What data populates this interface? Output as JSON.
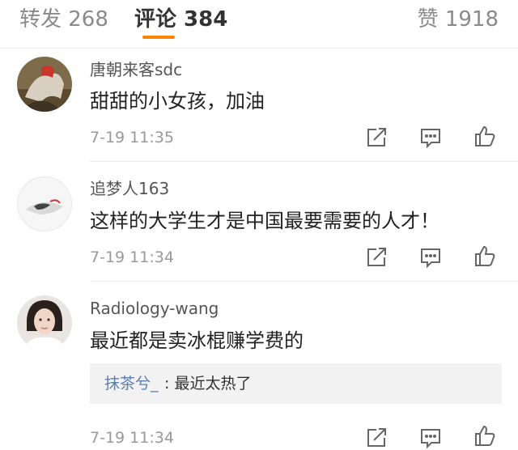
{
  "tabs": {
    "repost": "转发 268",
    "comment": "评论 384",
    "like": "赞 1918"
  },
  "colors": {
    "accent": "#ff8200",
    "link": "#5b7fb2",
    "meta": "#999999"
  },
  "comments": [
    {
      "user": "唐朝来客sdc",
      "text": "甜甜的小女孩，加油",
      "time": "7-19 11:35"
    },
    {
      "user": "追梦人163",
      "text": "这样的大学生才是中国最要需要的人才！",
      "time": "7-19 11:34"
    },
    {
      "user": "Radiology-wang",
      "text": "最近都是卖冰棍赚学费的",
      "time": "7-19 11:34",
      "reply": {
        "user": "抹茶兮_",
        "text": ": 最近太热了"
      }
    }
  ],
  "icons": [
    "share-icon",
    "comment-icon",
    "like-icon"
  ]
}
